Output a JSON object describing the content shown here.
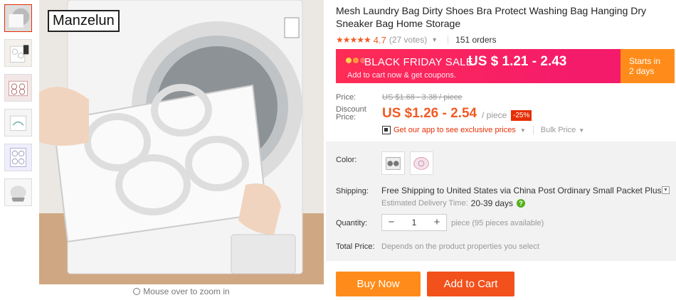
{
  "gallery": {
    "brand": "Manzelun",
    "zoom_hint": "Mouse over to zoom in"
  },
  "product": {
    "title": "Mesh Laundry Bag Dirty Shoes Bra Protect Washing Bag Hanging Dry Sneaker Bag Home Storage",
    "stars": "★★★★★",
    "rating": "4.7",
    "votes": "(27 votes)",
    "orders": "151 orders"
  },
  "sale": {
    "title": "BLACK FRIDAY SALE",
    "price": "US $ 1.21 - 2.43",
    "subtitle": "Add to cart now & get coupons.",
    "starts_line1": "Starts in",
    "starts_line2": "2 days"
  },
  "pricing": {
    "price_label": "Price:",
    "old_price": "US $1.68 - 3.38 / piece",
    "discount_label": "Discount Price:",
    "new_price": "US $1.26 - 2.54",
    "per": "/ piece",
    "badge": "-25%",
    "app_link": "Get our app to see exclusive prices",
    "bulk": "Bulk Price"
  },
  "options": {
    "color_label": "Color:",
    "shipping_label": "Shipping:",
    "shipping_text": "Free Shipping to United States via China Post Ordinary Small Packet Plus",
    "delivery_label": "Estimated Delivery Time:",
    "delivery_days": "20-39 days",
    "quantity_label": "Quantity:",
    "quantity_minus": "−",
    "quantity_value": "1",
    "quantity_plus": "+",
    "quantity_note": "piece (95 pieces available)",
    "total_label": "Total Price:",
    "total_note": "Depends on the product properties you select"
  },
  "actions": {
    "buy_now": "Buy Now",
    "add_to_cart": "Add to Cart"
  },
  "colors": {
    "accent": "#f15a24",
    "sale_banner": "#f51b6b",
    "buy_now": "#ff8c1a",
    "add_to_cart": "#f2511b"
  }
}
